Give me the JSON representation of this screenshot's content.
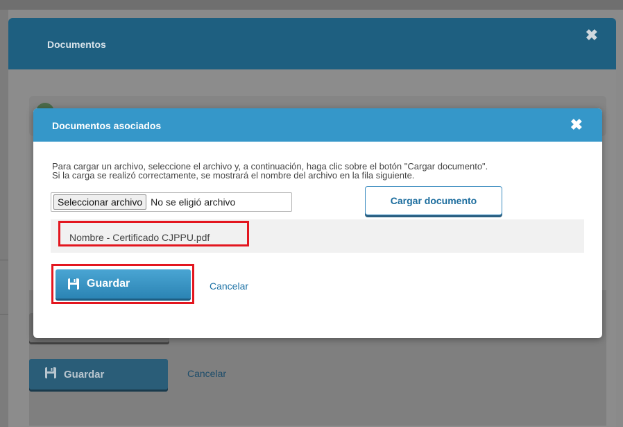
{
  "outer_modal": {
    "title": "Documentos",
    "close_glyph": "✖",
    "save_label": "Guardar",
    "cancel_label": "Cancelar"
  },
  "inner_modal": {
    "title": "Documentos asociados",
    "close_glyph": "✖",
    "instructions_line1": "Para cargar un archivo, seleccione el archivo y, a continuación, haga clic sobre el botón \"Cargar documento\".",
    "instructions_line2": "Si la carga se realizó correctamente, se mostrará el nombre del archivo en la fila siguiente.",
    "file_button_label": "Seleccionar archivo",
    "file_status": "No se eligió archivo",
    "upload_button_label": "Cargar documento",
    "uploaded_file_name": "Nombre - Certificado CJPPU.pdf",
    "save_label": "Guardar",
    "cancel_label": "Cancelar"
  },
  "icons": {
    "save": "floppy-disk-icon",
    "close": "close-icon"
  },
  "colors": {
    "inner_header": "#3597c9",
    "outer_header": "#1e5f80",
    "highlight": "#e3161f",
    "link": "#1f73a6"
  }
}
